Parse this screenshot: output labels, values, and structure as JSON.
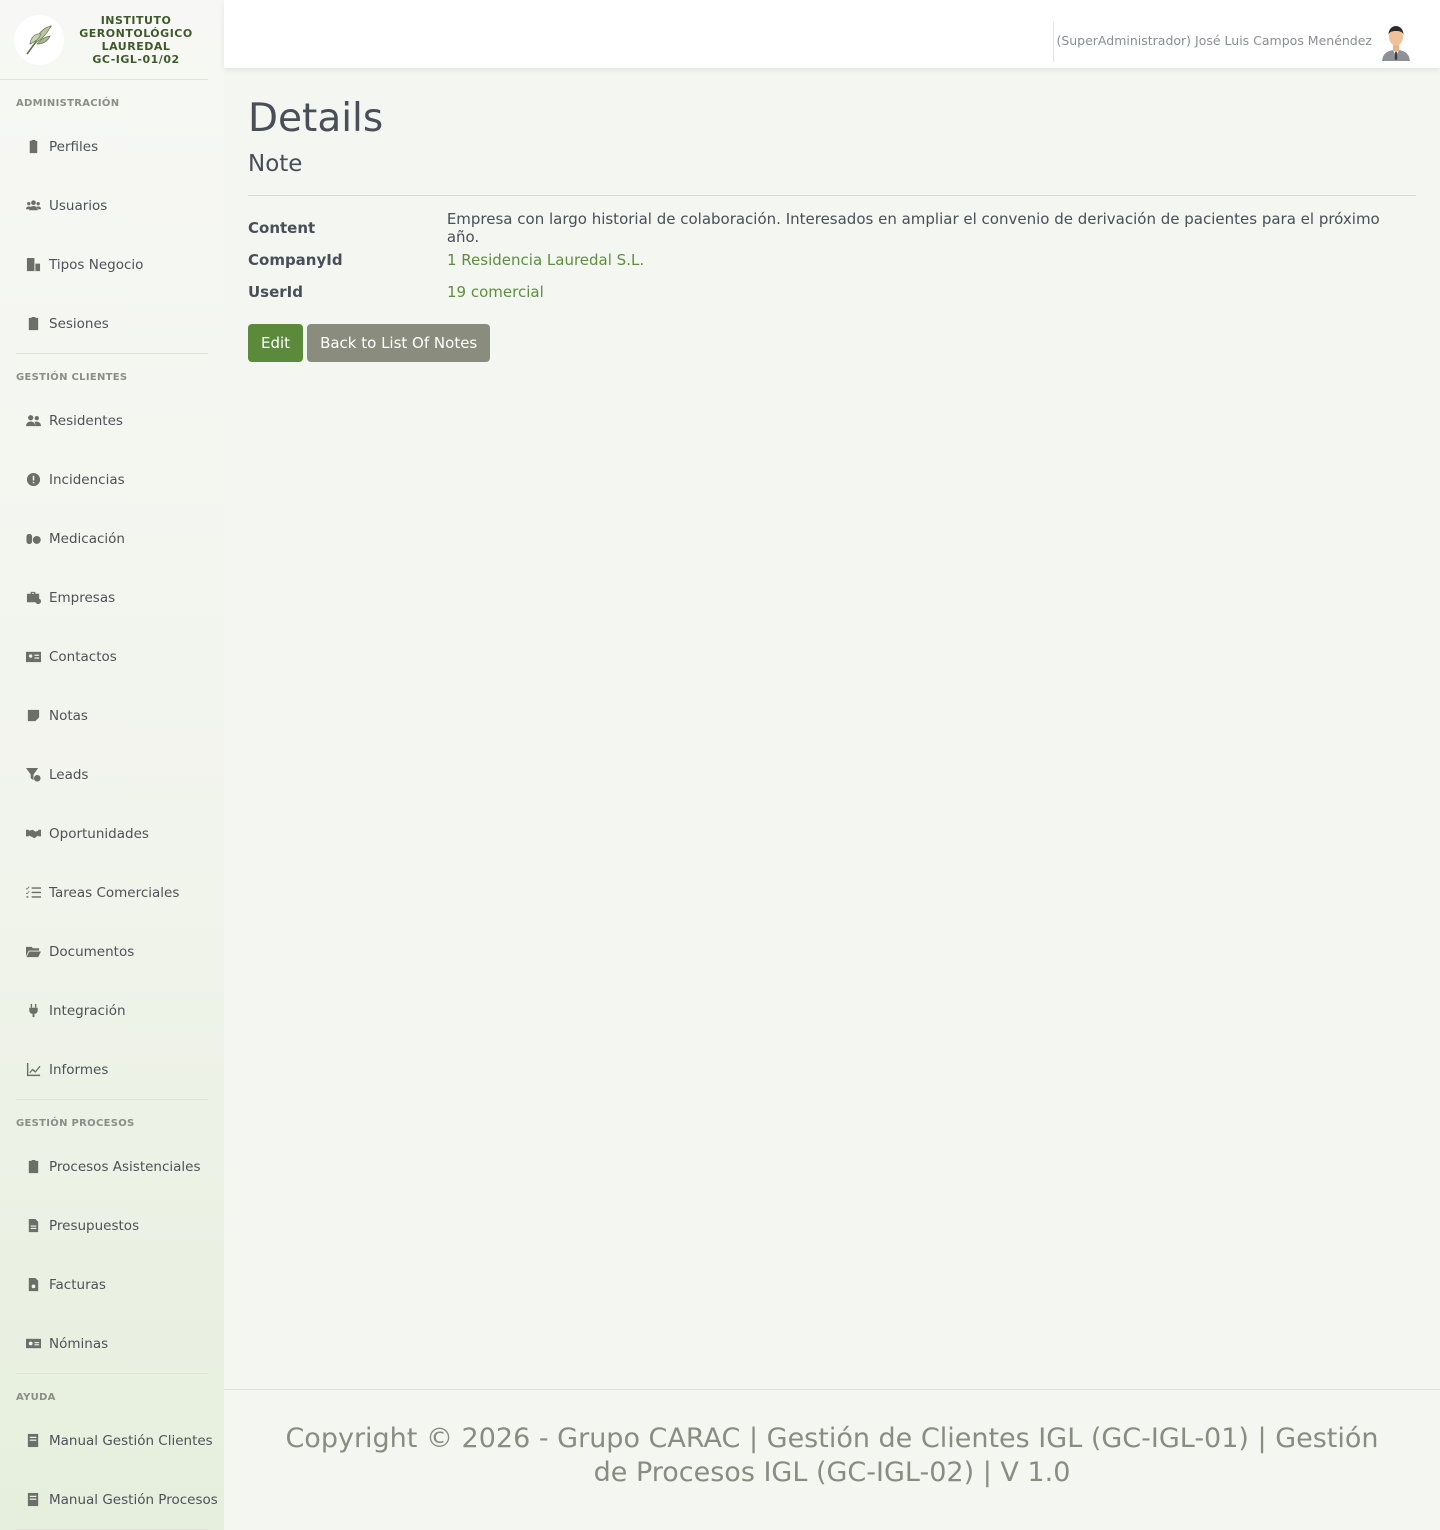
{
  "brand": {
    "line1": "INSTITUTO",
    "line2": "GERONTOLÓGICO",
    "line3": "LAUREDAL",
    "line4": "GC-IGL-01/02",
    "logo_icon": "leaf-logo"
  },
  "topbar": {
    "user_label": "(SuperAdministrador) José Luis Campos Menéndez",
    "avatar_icon": "user-avatar"
  },
  "sidebar": {
    "sections": [
      {
        "title": "ADMINISTRACIÓN",
        "items": [
          {
            "label": "Perfiles",
            "icon": "id-badge-icon"
          },
          {
            "label": "Usuarios",
            "icon": "users-icon"
          },
          {
            "label": "Tipos Negocio",
            "icon": "building-icon"
          },
          {
            "label": "Sesiones",
            "icon": "clipboard-icon"
          }
        ]
      },
      {
        "title": "GESTIÓN CLIENTES",
        "items": [
          {
            "label": "Residentes",
            "icon": "user-group-icon"
          },
          {
            "label": "Incidencias",
            "icon": "alert-circle-icon"
          },
          {
            "label": "Medicación",
            "icon": "pills-icon"
          },
          {
            "label": "Empresas",
            "icon": "briefcase-icon"
          },
          {
            "label": "Contactos",
            "icon": "contact-card-icon"
          },
          {
            "label": "Notas",
            "icon": "sticky-note-icon"
          },
          {
            "label": "Leads",
            "icon": "filter-icon"
          },
          {
            "label": "Oportunidades",
            "icon": "handshake-icon"
          },
          {
            "label": "Tareas Comerciales",
            "icon": "task-list-icon"
          },
          {
            "label": "Documentos",
            "icon": "folder-open-icon"
          },
          {
            "label": "Integración",
            "icon": "plug-icon"
          },
          {
            "label": "Informes",
            "icon": "line-chart-icon"
          }
        ]
      },
      {
        "title": "GESTIÓN PROCESOS",
        "items": [
          {
            "label": "Procesos Asistenciales",
            "icon": "clipboard-icon"
          },
          {
            "label": "Presupuestos",
            "icon": "file-icon"
          },
          {
            "label": "Facturas",
            "icon": "invoice-icon"
          },
          {
            "label": "Nóminas",
            "icon": "money-bill-icon"
          }
        ]
      },
      {
        "title": "AYUDA",
        "items": [
          {
            "label": "Manual Gestión Clientes",
            "icon": "book-icon"
          },
          {
            "label": "Manual Gestión Procesos",
            "icon": "book-icon"
          }
        ]
      }
    ]
  },
  "main": {
    "title": "Details",
    "subtitle": "Note",
    "fields": [
      {
        "label": "Content",
        "value": "Empresa con largo historial de colaboración. Interesados en ampliar el convenio de derivación de pacientes para el próximo año.",
        "link": false
      },
      {
        "label": "CompanyId",
        "value": "1 Residencia Lauredal S.L.",
        "link": true
      },
      {
        "label": "UserId",
        "value": "19 comercial",
        "link": true
      }
    ],
    "edit_label": "Edit",
    "back_label": "Back to List Of Notes"
  },
  "footer": {
    "text": "Copyright © 2026 - Grupo CARAC | Gestión de Clientes IGL (GC-IGL-01) | Gestión de Procesos IGL (GC-IGL-02) | V 1.0"
  },
  "colors": {
    "accent": "#5b8a3a",
    "link": "#5e8e3b",
    "secondary_button": "#8a8c7e"
  }
}
